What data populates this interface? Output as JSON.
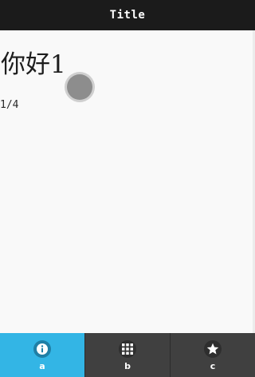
{
  "header": {
    "title": "Title"
  },
  "main": {
    "greeting": "你好1",
    "pager": "1/4"
  },
  "tabs": [
    {
      "label": "a",
      "icon": "info-icon",
      "active": true
    },
    {
      "label": "b",
      "icon": "grid-icon",
      "active": false
    },
    {
      "label": "c",
      "icon": "star-icon",
      "active": false
    }
  ],
  "colors": {
    "header_bg": "#1b1b1b",
    "tab_active_bg": "#33b5e5",
    "tab_inactive_bg": "#404040"
  }
}
